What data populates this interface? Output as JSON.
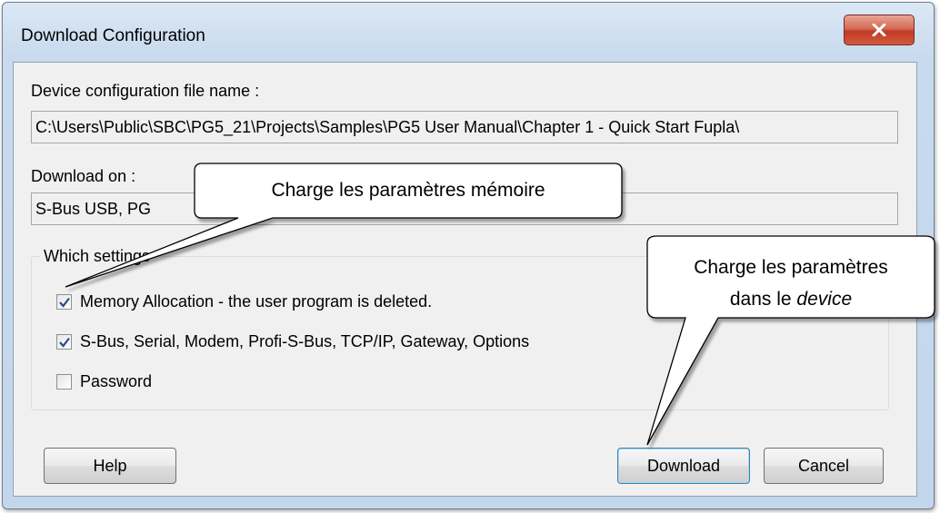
{
  "window": {
    "title": "Download Configuration",
    "close_label": "X"
  },
  "config_file": {
    "label": "Device configuration file name :",
    "value": "C:\\Users\\Public\\SBC\\PG5_21\\Projects\\Samples\\PG5 User Manual\\Chapter 1 - Quick Start Fupla\\"
  },
  "download_on": {
    "label": "Download on :",
    "value": "S-Bus USB, PG"
  },
  "settings": {
    "title": "Which settings",
    "items": [
      {
        "label": "Memory Allocation - the user program is deleted.",
        "checked": true
      },
      {
        "label": "S-Bus, Serial, Modem, Profi-S-Bus, TCP/IP, Gateway, Options",
        "checked": true
      },
      {
        "label": "Password",
        "checked": false
      }
    ]
  },
  "buttons": {
    "help": "Help",
    "download": "Download",
    "cancel": "Cancel"
  },
  "callouts": {
    "memory": "Charge les  paramètres mémoire",
    "device_line1": "Charge les paramètres",
    "device_line2_prefix": "dans le ",
    "device_line2_em": "device"
  }
}
